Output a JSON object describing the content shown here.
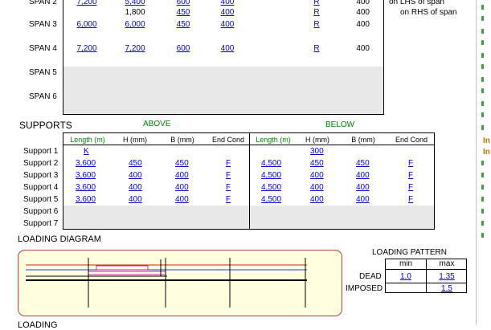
{
  "spans": [
    {
      "label": "SPAN 2",
      "v1": "7,200",
      "v2": "5,400",
      "v3": "600",
      "v4": "400",
      "cond": "R",
      "end": "400",
      "note": "on LHS of span"
    },
    {
      "label": "",
      "v1": "",
      "v2": "1,800",
      "v3": "450",
      "v4": "400",
      "cond": "R",
      "end": "400",
      "note": "on RHS of span"
    },
    {
      "label": "SPAN 3",
      "v1": "6,000",
      "v2": "6,000",
      "v3": "450",
      "v4": "400",
      "cond": "R",
      "end": "400",
      "note": ""
    },
    {
      "label": "SPAN 4",
      "v1": "7,200",
      "v2": "7,200",
      "v3": "600",
      "v4": "400",
      "cond": "R",
      "end": "400",
      "note": ""
    },
    {
      "label": "SPAN 5"
    },
    {
      "label": "SPAN 6"
    }
  ],
  "supports": {
    "title": "SUPPORTS",
    "above_label": "ABOVE",
    "below_label": "BELOW",
    "headers": {
      "above": [
        "Length (m)",
        "H (mm)",
        "B (mm)",
        "End Cond"
      ],
      "below": [
        "Length (m)",
        "H (mm)",
        "B (mm)",
        "End Cond"
      ]
    },
    "rows": [
      {
        "label": "Support 1",
        "a_len": "K",
        "a_h": "",
        "a_b": "",
        "a_ec": "",
        "b_len": "",
        "b_h": "300",
        "b_b": "",
        "b_ec": ""
      },
      {
        "label": "Support 2",
        "a_len": "3,600",
        "a_h": "450",
        "a_b": "450",
        "a_ec": "F",
        "b_len": "4,500",
        "b_h": "450",
        "b_b": "450",
        "b_ec": "F"
      },
      {
        "label": "Support 3",
        "a_len": "3,600",
        "a_h": "400",
        "a_b": "400",
        "a_ec": "F",
        "b_len": "4,500",
        "b_h": "400",
        "b_b": "400",
        "b_ec": "F"
      },
      {
        "label": "Support 4",
        "a_len": "3,600",
        "a_h": "400",
        "a_b": "400",
        "a_ec": "F",
        "b_len": "4,500",
        "b_h": "400",
        "b_b": "400",
        "b_ec": "F"
      },
      {
        "label": "Support 5",
        "a_len": "3,600",
        "a_h": "400",
        "a_b": "400",
        "a_ec": "F",
        "b_len": "4,500",
        "b_h": "400",
        "b_b": "400",
        "b_ec": "F"
      },
      {
        "label": "Support 6"
      },
      {
        "label": "Support 7"
      }
    ]
  },
  "loading_diagram": {
    "title": "LOADING DIAGRAM"
  },
  "loading_pattern": {
    "title": "LOADING PATTERN",
    "col_min": "min",
    "col_max": "max",
    "dead_label": "DEAD",
    "dead_min": "1.0",
    "dead_max": "1.35",
    "imposed_label": "IMPOSED",
    "imposed_max": "1.5"
  },
  "right_marks": [
    "In",
    "In"
  ],
  "bottom_text": "LOADING",
  "colors": {
    "link": "#0000cc",
    "green": "#008000",
    "grey": "#e8e8e8",
    "diagram_bg": "#ffffe0",
    "diagram_border": "#c04040"
  }
}
